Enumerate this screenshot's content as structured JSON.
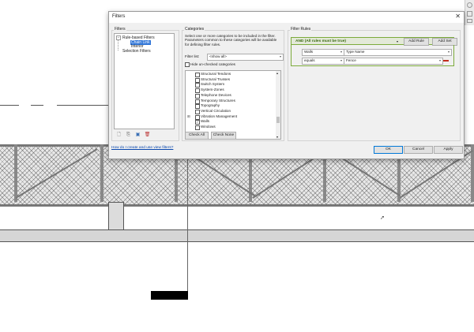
{
  "dialog": {
    "title": "Filters",
    "close_glyph": "✕"
  },
  "filters_panel": {
    "label": "Filters",
    "tree": [
      {
        "label": "Rule-based Filters",
        "type": "group"
      },
      {
        "label": "Chain Link",
        "type": "item",
        "selected": true
      },
      {
        "label": "Interior",
        "type": "item",
        "selected": false
      },
      {
        "label": "Selection Filters",
        "type": "group"
      }
    ],
    "icons": [
      "new-filter-icon",
      "duplicate-filter-icon",
      "rename-filter-icon",
      "delete-filter-icon"
    ]
  },
  "categories_panel": {
    "label": "Categories",
    "description": "Select one or more categories to be included in the filter. Parameters common to these categories will be available for defining filter rules.",
    "filter_list_label": "Filter list:",
    "filter_list_value": "<show all>",
    "hide_unchecked_label": "Hide un-checked categories",
    "items": [
      {
        "label": "Structural Tendons",
        "checked": false,
        "expandable": false
      },
      {
        "label": "Structural Trusses",
        "checked": false,
        "expandable": false
      },
      {
        "label": "Switch System",
        "checked": false,
        "expandable": false
      },
      {
        "label": "System-Zones",
        "checked": false,
        "expandable": false
      },
      {
        "label": "Telephone Devices",
        "checked": false,
        "expandable": false
      },
      {
        "label": "Temporary Structures",
        "checked": false,
        "expandable": false
      },
      {
        "label": "Topography",
        "checked": false,
        "expandable": false
      },
      {
        "label": "Vertical Circulation",
        "checked": false,
        "expandable": false
      },
      {
        "label": "Vibration Management",
        "checked": false,
        "expandable": true
      },
      {
        "label": "Walls",
        "checked": true,
        "expandable": false
      },
      {
        "label": "Windows",
        "checked": false,
        "expandable": false
      }
    ],
    "check_all": "Check All",
    "check_none": "Check None"
  },
  "rules_panel": {
    "label": "Filter Rules",
    "header": "AND (All rules must be true)",
    "add_rule": "Add Rule",
    "add_set": "Add Set",
    "category": "Walls",
    "parameter": "Type Name",
    "operator": "equals",
    "value": "Fence"
  },
  "footer": {
    "help_link": "How do I create and use view filters?",
    "ok": "OK",
    "cancel": "Cancel",
    "apply": "Apply"
  },
  "colors": {
    "accent": "#0078d7",
    "selection": "#3176d8",
    "rule_header_green": "#7cab3b",
    "remove_red": "#c42b1c"
  }
}
